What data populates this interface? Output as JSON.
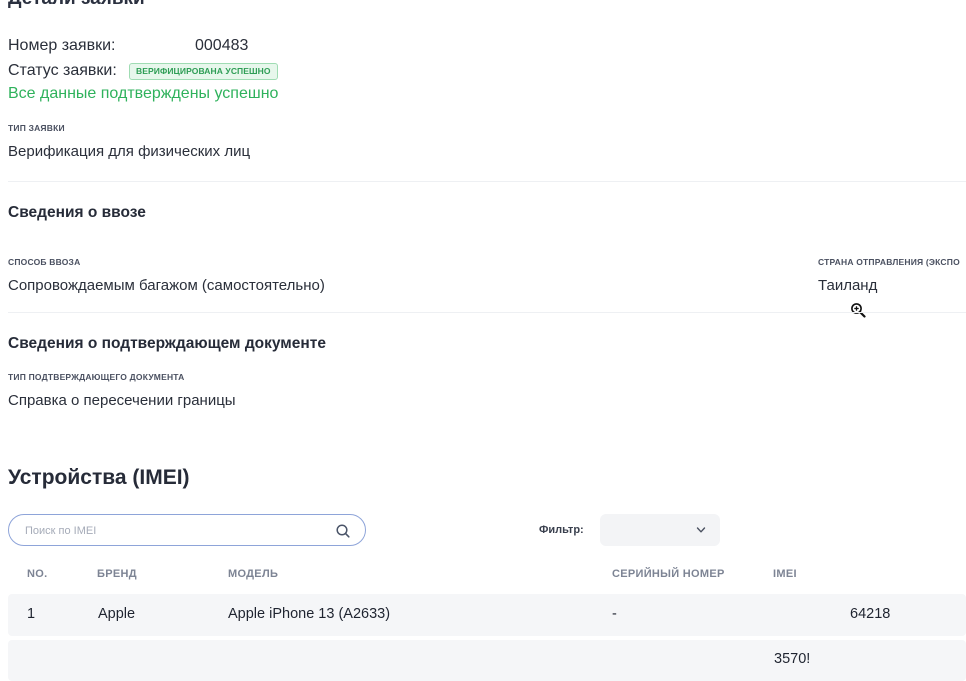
{
  "header": {
    "title": "Детали заявки"
  },
  "application": {
    "number_label": "Номер заявки:",
    "number_value": "000483",
    "status_label": "Статус заявки:",
    "status_badge": "ВЕРИФИЦИРОВАНА УСПЕШНО",
    "success_message": "Все данные подтверждены успешно",
    "type_caption": "ТИП ЗАЯВКИ",
    "type_value": "Верификация для физических лиц"
  },
  "import_info": {
    "heading": "Сведения о ввозе",
    "method_caption": "СПОСОБ ВВОЗА",
    "method_value": "Сопровождаемым багажом (самостоятельно)",
    "country_caption": "СТРАНА ОТПРАВЛЕНИЯ (ЭКСПО",
    "country_value": "Таиланд"
  },
  "document_info": {
    "heading": "Сведения о подтверждающем документе",
    "doc_type_caption": "ТИП ПОДТВЕРЖДАЮЩЕГО ДОКУМЕНТА",
    "doc_type_value": "Справка о пересечении границы"
  },
  "devices": {
    "heading": "Устройства (IMEI)",
    "search_placeholder": "Поиск по IMEI",
    "filter_label": "Фильтр:",
    "filter_value": "",
    "columns": [
      "NO.",
      "БРЕНД",
      "МОДЕЛЬ",
      "СЕРИЙНЫЙ НОМЕР",
      "IMEI"
    ],
    "rows": [
      {
        "no": "1",
        "brand": "Apple",
        "model": "Apple iPhone 13 (A2633)",
        "serial": "-",
        "imei": "64218"
      },
      {
        "no": "",
        "brand": "",
        "model": "",
        "serial": "",
        "imei": "3570!"
      }
    ]
  },
  "colors": {
    "success": "#2fb25c",
    "accent_border": "#8ea4d9",
    "row_bg": "#f5f6f8"
  },
  "icons": {
    "search": "search-icon",
    "chevron": "chevron-down-icon",
    "zoom_cursor": "zoom-in-cursor-icon"
  }
}
